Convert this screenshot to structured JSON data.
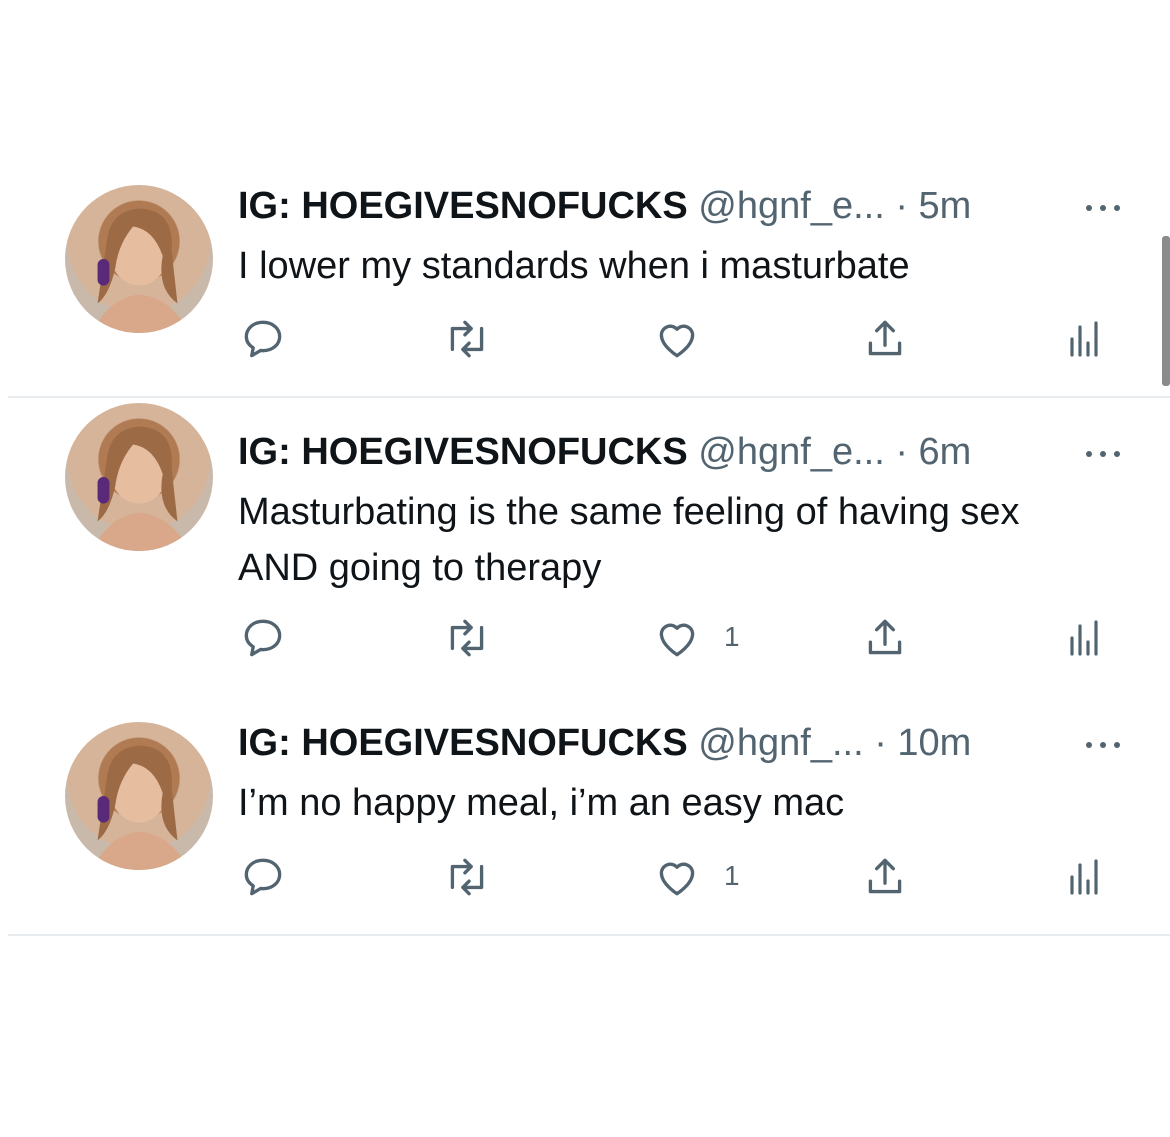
{
  "tweets": [
    {
      "name": "IG: HOEGIVESNOFUCKS",
      "handle": "@hgnf_e...",
      "time": "· 5m",
      "text": "I lower my standards when i masturbate",
      "likes": ""
    },
    {
      "name": "IG: HOEGIVESNOFUCKS",
      "handle": "@hgnf_e...",
      "time": "· 6m",
      "text": "Masturbating is the same feeling of having sex AND going to therapy",
      "likes": "1"
    },
    {
      "name": "IG: HOEGIVESNOFUCKS",
      "handle": "@hgnf_...",
      "time": "· 10m",
      "text": "I’m no happy meal, i’m an easy mac",
      "likes": "1"
    }
  ],
  "icons": {
    "reply": "reply-icon",
    "retweet": "retweet-icon",
    "like": "heart-icon",
    "share": "share-icon",
    "analytics": "analytics-icon",
    "more": "more-icon"
  },
  "colors": {
    "text": "#0f1419",
    "muted": "#536471",
    "divider": "#e6ecf0",
    "background": "#ffffff"
  }
}
